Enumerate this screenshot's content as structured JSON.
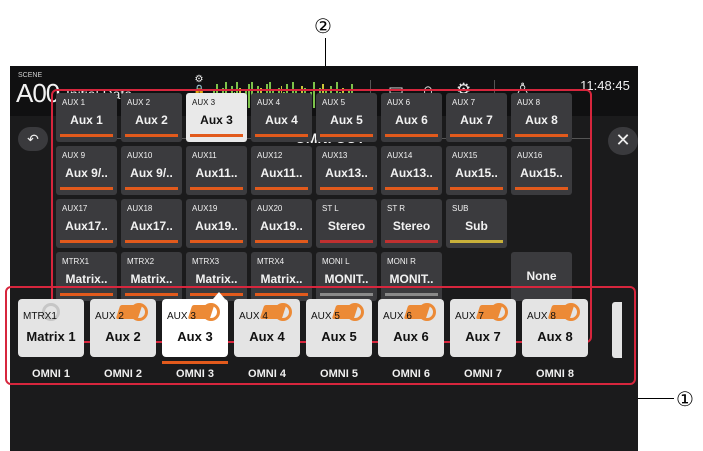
{
  "callouts": {
    "top": "②",
    "right": "①"
  },
  "topbar": {
    "scene_label": "SCENE",
    "scene_number": "A00",
    "scene_title": "Initial Data",
    "clock": "11:48:45",
    "icons": [
      "lock-icon",
      "meter-icon",
      "tape-recorder-icon",
      "headphones-icon",
      "gear-icon",
      "user-icon"
    ]
  },
  "dialog": {
    "title": "OMNI OUT",
    "back": "↶",
    "close": "✕"
  },
  "grid": [
    {
      "small": "AUX 1",
      "big": "Aux 1",
      "bar": "aux"
    },
    {
      "small": "AUX 2",
      "big": "Aux 2",
      "bar": "aux"
    },
    {
      "small": "AUX 3",
      "big": "Aux 3",
      "bar": "aux",
      "selected": true
    },
    {
      "small": "AUX 4",
      "big": "Aux 4",
      "bar": "aux"
    },
    {
      "small": "AUX 5",
      "big": "Aux 5",
      "bar": "aux"
    },
    {
      "small": "AUX 6",
      "big": "Aux 6",
      "bar": "aux"
    },
    {
      "small": "AUX 7",
      "big": "Aux 7",
      "bar": "aux"
    },
    {
      "small": "AUX 8",
      "big": "Aux 8",
      "bar": "aux"
    },
    {
      "small": "AUX 9",
      "big": "Aux 9/..",
      "bar": "aux"
    },
    {
      "small": "AUX10",
      "big": "Aux 9/..",
      "bar": "aux"
    },
    {
      "small": "AUX11",
      "big": "Aux11..",
      "bar": "aux"
    },
    {
      "small": "AUX12",
      "big": "Aux11..",
      "bar": "aux"
    },
    {
      "small": "AUX13",
      "big": "Aux13..",
      "bar": "aux"
    },
    {
      "small": "AUX14",
      "big": "Aux13..",
      "bar": "aux"
    },
    {
      "small": "AUX15",
      "big": "Aux15..",
      "bar": "aux"
    },
    {
      "small": "AUX16",
      "big": "Aux15..",
      "bar": "aux"
    },
    {
      "small": "AUX17",
      "big": "Aux17..",
      "bar": "aux"
    },
    {
      "small": "AUX18",
      "big": "Aux17..",
      "bar": "aux"
    },
    {
      "small": "AUX19",
      "big": "Aux19..",
      "bar": "aux"
    },
    {
      "small": "AUX20",
      "big": "Aux19..",
      "bar": "aux"
    },
    {
      "small": "ST L",
      "big": "Stereo",
      "bar": "stereo"
    },
    {
      "small": "ST R",
      "big": "Stereo",
      "bar": "stereo"
    },
    {
      "small": "SUB",
      "big": "Sub",
      "bar": "sub"
    },
    {
      "small": "",
      "big": "",
      "bar": "",
      "empty": true
    },
    {
      "small": "MTRX1",
      "big": "Matrix..",
      "bar": "aux"
    },
    {
      "small": "MTRX2",
      "big": "Matrix..",
      "bar": "aux"
    },
    {
      "small": "MTRX3",
      "big": "Matrix..",
      "bar": "aux"
    },
    {
      "small": "MTRX4",
      "big": "Matrix..",
      "bar": "aux"
    },
    {
      "small": "MONI L",
      "big": "MONIT..",
      "bar": "moni"
    },
    {
      "small": "MONI R",
      "big": "MONIT..",
      "bar": "moni"
    },
    {
      "small": "",
      "big": "",
      "bar": "",
      "empty": true
    },
    {
      "small": "",
      "big": "None",
      "bar": "",
      "none": true
    }
  ],
  "omni": [
    {
      "small": "MTRX1",
      "big": "Matrix 1",
      "label": "OMNI 1",
      "icon": "grey"
    },
    {
      "small": "AUX 2",
      "big": "Aux 2",
      "label": "OMNI 2",
      "icon": "orange"
    },
    {
      "small": "AUX 3",
      "big": "Aux 3",
      "label": "OMNI 3",
      "icon": "orange",
      "selected": true
    },
    {
      "small": "AUX 4",
      "big": "Aux 4",
      "label": "OMNI 4",
      "icon": "orange"
    },
    {
      "small": "AUX 5",
      "big": "Aux 5",
      "label": "OMNI 5",
      "icon": "orange"
    },
    {
      "small": "AUX 6",
      "big": "Aux 6",
      "label": "OMNI 6",
      "icon": "orange"
    },
    {
      "small": "AUX 7",
      "big": "Aux 7",
      "label": "OMNI 7",
      "icon": "orange"
    },
    {
      "small": "AUX 8",
      "big": "Aux 8",
      "label": "OMNI 8",
      "icon": "orange"
    }
  ],
  "colors": {
    "accent": "#e25a1c",
    "callout_frame": "#d7263d",
    "background": "#1b1b1c"
  }
}
